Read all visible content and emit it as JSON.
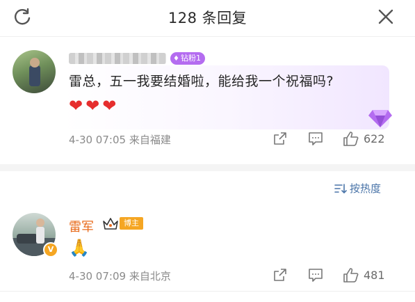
{
  "header": {
    "title": "128 条回复",
    "refresh_icon": "refresh-icon",
    "close_icon": "close-icon"
  },
  "comments": [
    {
      "username": "",
      "badge": "钻粉1",
      "text": "雷总，五一我要结婚啦，能给我一个祝福吗?",
      "emoji": "❤❤❤",
      "time": "4-30 07:05",
      "location": "来自福建",
      "likes": "622"
    },
    {
      "username": "雷军",
      "badge": "博主",
      "verified": "V",
      "emoji": "🙏",
      "time": "4-30 07:09",
      "location": "来自北京",
      "likes": "481"
    }
  ],
  "sort": {
    "label": "按热度"
  },
  "colors": {
    "accent": "#4a74a8",
    "name_orange": "#e86b1c",
    "badge_purple": "#b46cf0",
    "badge_orange": "#f5a623"
  }
}
